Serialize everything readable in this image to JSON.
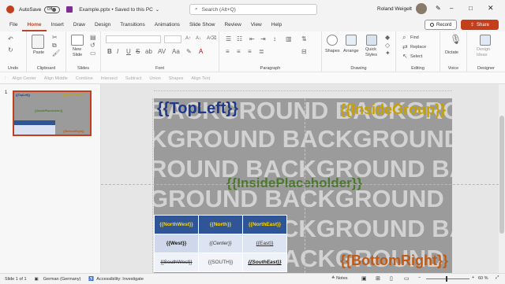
{
  "titlebar": {
    "autosave_label": "AutoSave",
    "autosave_state": "Off",
    "doc_title": "Example.pptx • Saved to this PC",
    "search_placeholder": "Search (Alt+Q)",
    "user_name": "Roland Weigelt"
  },
  "record_label": "Record",
  "share_label": "Share",
  "tabs": [
    "File",
    "Home",
    "Insert",
    "Draw",
    "Design",
    "Transitions",
    "Animations",
    "Slide Show",
    "Review",
    "View",
    "Help"
  ],
  "active_tab": "Home",
  "ribbon": {
    "groups": [
      "Undo",
      "Clipboard",
      "Slides",
      "Font",
      "Paragraph",
      "Drawing",
      "Editing",
      "Voice",
      "Designer"
    ],
    "paste": "Paste",
    "new_slide": "New\nSlide",
    "shapes": "Shapes",
    "arrange": "Arrange",
    "quick_styles": "Quick\nStyles",
    "find": "Find",
    "replace": "Replace",
    "select": "Select",
    "dictate": "Dictate",
    "design_ideas": "Design\nIdeas"
  },
  "shapebar": [
    "Align Center",
    "Align Middle",
    "Combine",
    "Intersect",
    "Subtract",
    "Union",
    "Shapes",
    "Align Text"
  ],
  "thumbnail": {
    "number": "1"
  },
  "slide": {
    "background_words": [
      "BACKGROUND BACKGROUND BAC",
      "KGROUND BACKGROUND BAC",
      "ROUND BACKGROUND BACKG",
      "GROUND BACKGROUND BACKGRO",
      "ROUND BACKGROUND BACKG",
      "GROUND BACKGROUND BACKGRO"
    ],
    "top_left": "{{TopLeft}}",
    "inside_group": "{{InsideGroup}}",
    "inside_placeholder": "{{InsidePlaceholder}}",
    "bottom_right": "{{BottomRight}}",
    "table": [
      [
        "{{NorthWest}}",
        "{{North}}",
        "{{NorthEast}}"
      ],
      [
        "{{West}}",
        "{{Center}}",
        "{{East}}"
      ],
      [
        "{{SouthWest}}",
        "{{SOUTH}}",
        "{{SouthEast}}"
      ]
    ]
  },
  "status": {
    "slide_of": "Slide 1 of 1",
    "language": "German (Germany)",
    "accessibility": "Accessibility: Investigate",
    "notes": "Notes",
    "zoom": "60 %"
  },
  "colors": {
    "accent": "#b7472a",
    "top_left": "#1f3a8a",
    "inside_group": "#c8a200",
    "inside_placeholder": "#4a7a2a",
    "bottom_right": "#c05a15",
    "table_header": "#2f5597"
  }
}
